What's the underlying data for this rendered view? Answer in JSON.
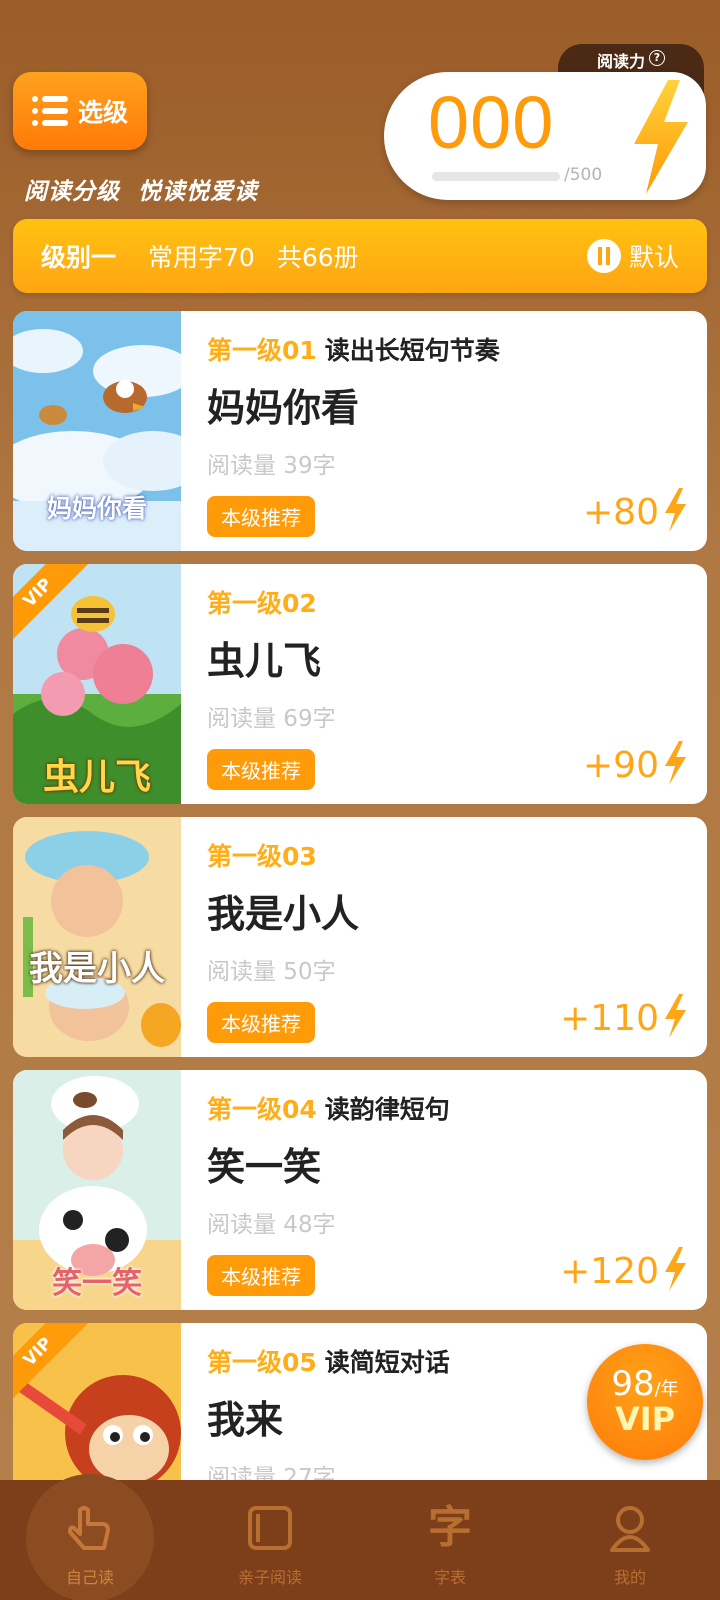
{
  "header": {
    "select_label": "选级",
    "slogan": "阅读分级  悦读悦爱读",
    "power_label": "阅读力",
    "power_value": "000",
    "power_max": "/500",
    "power_progress": 0
  },
  "level_bar": {
    "name": "级别一",
    "chars": "常用字70",
    "count": "共66册",
    "sort_label": "默认"
  },
  "books": [
    {
      "level": "第一级01",
      "tag": "读出长短句节奏",
      "title": "妈妈你看",
      "cover_title": "妈妈你看",
      "read_count": "阅读量 39字",
      "badge": "本级推荐",
      "points": "+80",
      "vip": false
    },
    {
      "level": "第一级02",
      "tag": "",
      "title": "虫儿飞",
      "cover_title": "虫儿飞",
      "read_count": "阅读量 69字",
      "badge": "本级推荐",
      "points": "+90",
      "vip": true
    },
    {
      "level": "第一级03",
      "tag": "",
      "title": "我是小人",
      "cover_title": "我是小人",
      "read_count": "阅读量 50字",
      "badge": "本级推荐",
      "points": "+110",
      "vip": false
    },
    {
      "level": "第一级04",
      "tag": "读韵律短句",
      "title": "笑一笑",
      "cover_title": "笑一笑",
      "read_count": "阅读量 48字",
      "badge": "本级推荐",
      "points": "+120",
      "vip": false
    },
    {
      "level": "第一级05",
      "tag": "读简短对话",
      "title": "我来",
      "cover_title": "",
      "read_count": "阅读量 27字",
      "badge": "",
      "points": "",
      "vip": true
    }
  ],
  "vip_promo": {
    "price": "98",
    "unit": "/年",
    "label": "VIP"
  },
  "nav": [
    {
      "label": "自己读",
      "icon": "hand-icon",
      "active": true
    },
    {
      "label": "亲子阅读",
      "icon": "book-icon",
      "active": false
    },
    {
      "label": "字表",
      "icon": "zi-icon",
      "glyph": "字",
      "active": false
    },
    {
      "label": "我的",
      "icon": "person-icon",
      "active": false
    }
  ],
  "colors": {
    "accent": "#ff9a08",
    "level_yellow": "#ffae1a",
    "nav_bg": "#7c3f1a"
  }
}
